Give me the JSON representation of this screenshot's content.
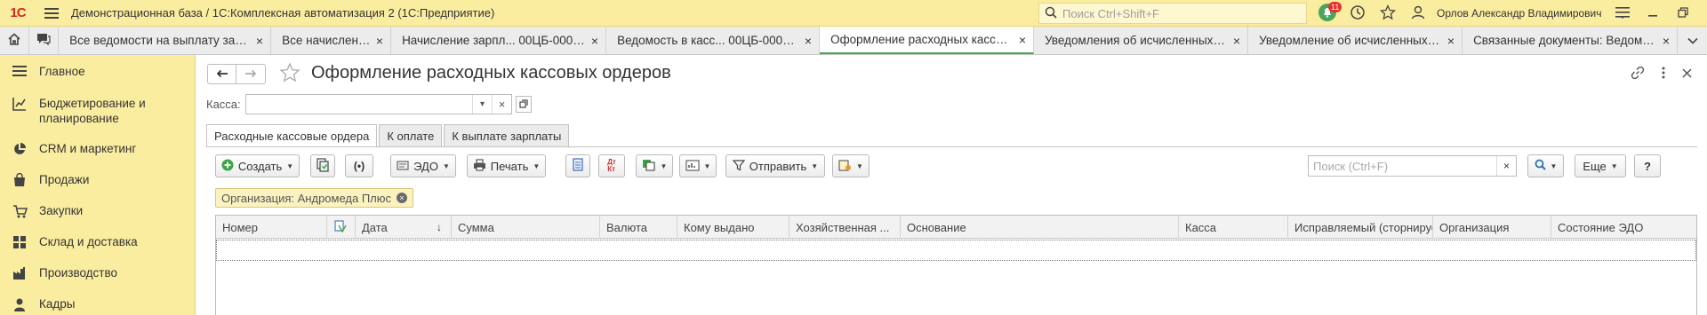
{
  "titlebar": {
    "logo": "1С",
    "title": "Демонстрационная база / 1С:Комплексная автоматизация 2  (1С:Предприятие)",
    "search_placeholder": "Поиск Ctrl+Shift+F",
    "notifications_count": "11",
    "user_name": "Орлов Александр Владимирович"
  },
  "tabs": [
    {
      "label": "Все ведомости на выплату зарпл..."
    },
    {
      "label": "Все начисления"
    },
    {
      "label": "Начисление зарпл...   00ЦБ-000001"
    },
    {
      "label": "Ведомость в касс...   00ЦБ-000001"
    },
    {
      "label": "Оформление расходных кассовых ..."
    },
    {
      "label": "Уведомления об исчисленных с..."
    },
    {
      "label": "Уведомление об исчисленных с..."
    },
    {
      "label": "Связанные документы: Ведомо..."
    }
  ],
  "sidebar": {
    "items": [
      {
        "label": "Главное"
      },
      {
        "label": "Бюджетирование и планирование"
      },
      {
        "label": "CRM и маркетинг"
      },
      {
        "label": "Продажи"
      },
      {
        "label": "Закупки"
      },
      {
        "label": "Склад и доставка"
      },
      {
        "label": "Производство"
      },
      {
        "label": "Кадры"
      }
    ]
  },
  "form": {
    "title": "Оформление расходных кассовых ордеров",
    "kassa_label": "Касса:",
    "kassa_value": "",
    "tabs": [
      {
        "label": "Расходные кассовые ордера"
      },
      {
        "label": "К оплате"
      },
      {
        "label": "К выплате зарплаты"
      }
    ],
    "toolbar": {
      "create": "Создать",
      "edo": "ЭДО",
      "print": "Печать",
      "send": "Отправить",
      "search_placeholder": "Поиск (Ctrl+F)",
      "more": "Еще",
      "help": "?"
    },
    "filter_tag": "Организация: Андромеда Плюс",
    "columns": [
      {
        "label": "Номер"
      },
      {
        "label": ""
      },
      {
        "label": "Дата"
      },
      {
        "label": "Сумма"
      },
      {
        "label": "Валюта"
      },
      {
        "label": "Кому выдано"
      },
      {
        "label": "Хозяйственная ..."
      },
      {
        "label": "Основание"
      },
      {
        "label": "Касса"
      },
      {
        "label": "Исправляемый (сторнируем..."
      },
      {
        "label": "Организация"
      },
      {
        "label": "Состояние ЭДО"
      }
    ]
  },
  "colors": {
    "panel_yellow": "#fbeda0",
    "active_tab_accent": "#4aa65b",
    "logo_red": "#d9251d",
    "notification_badge": "#e3302f"
  }
}
